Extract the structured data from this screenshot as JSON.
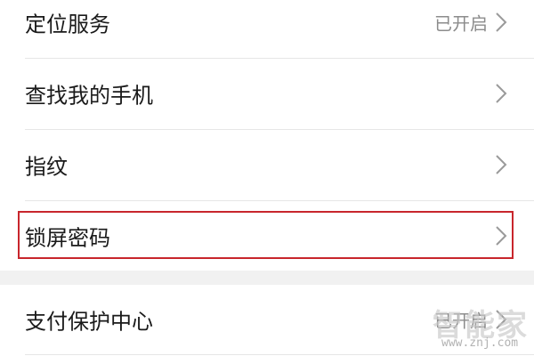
{
  "settings": {
    "rows": [
      {
        "label": "定位服务",
        "value": "已开启"
      },
      {
        "label": "查找我的手机",
        "value": ""
      },
      {
        "label": "指纹",
        "value": ""
      },
      {
        "label": "锁屏密码",
        "value": ""
      }
    ],
    "section2": {
      "rows": [
        {
          "label": "支付保护中心",
          "value": "已开启"
        }
      ]
    }
  },
  "watermark": {
    "text": "智能家",
    "url": "www.znj.com"
  },
  "colors": {
    "highlight_border": "#c8262c",
    "section_gap": "#f1f1f1",
    "divider": "#e6e6e6",
    "label_text": "#1a1a1a",
    "value_text": "#8c8c8c"
  },
  "icons": {
    "row_chevron": "chevron-right-icon"
  }
}
